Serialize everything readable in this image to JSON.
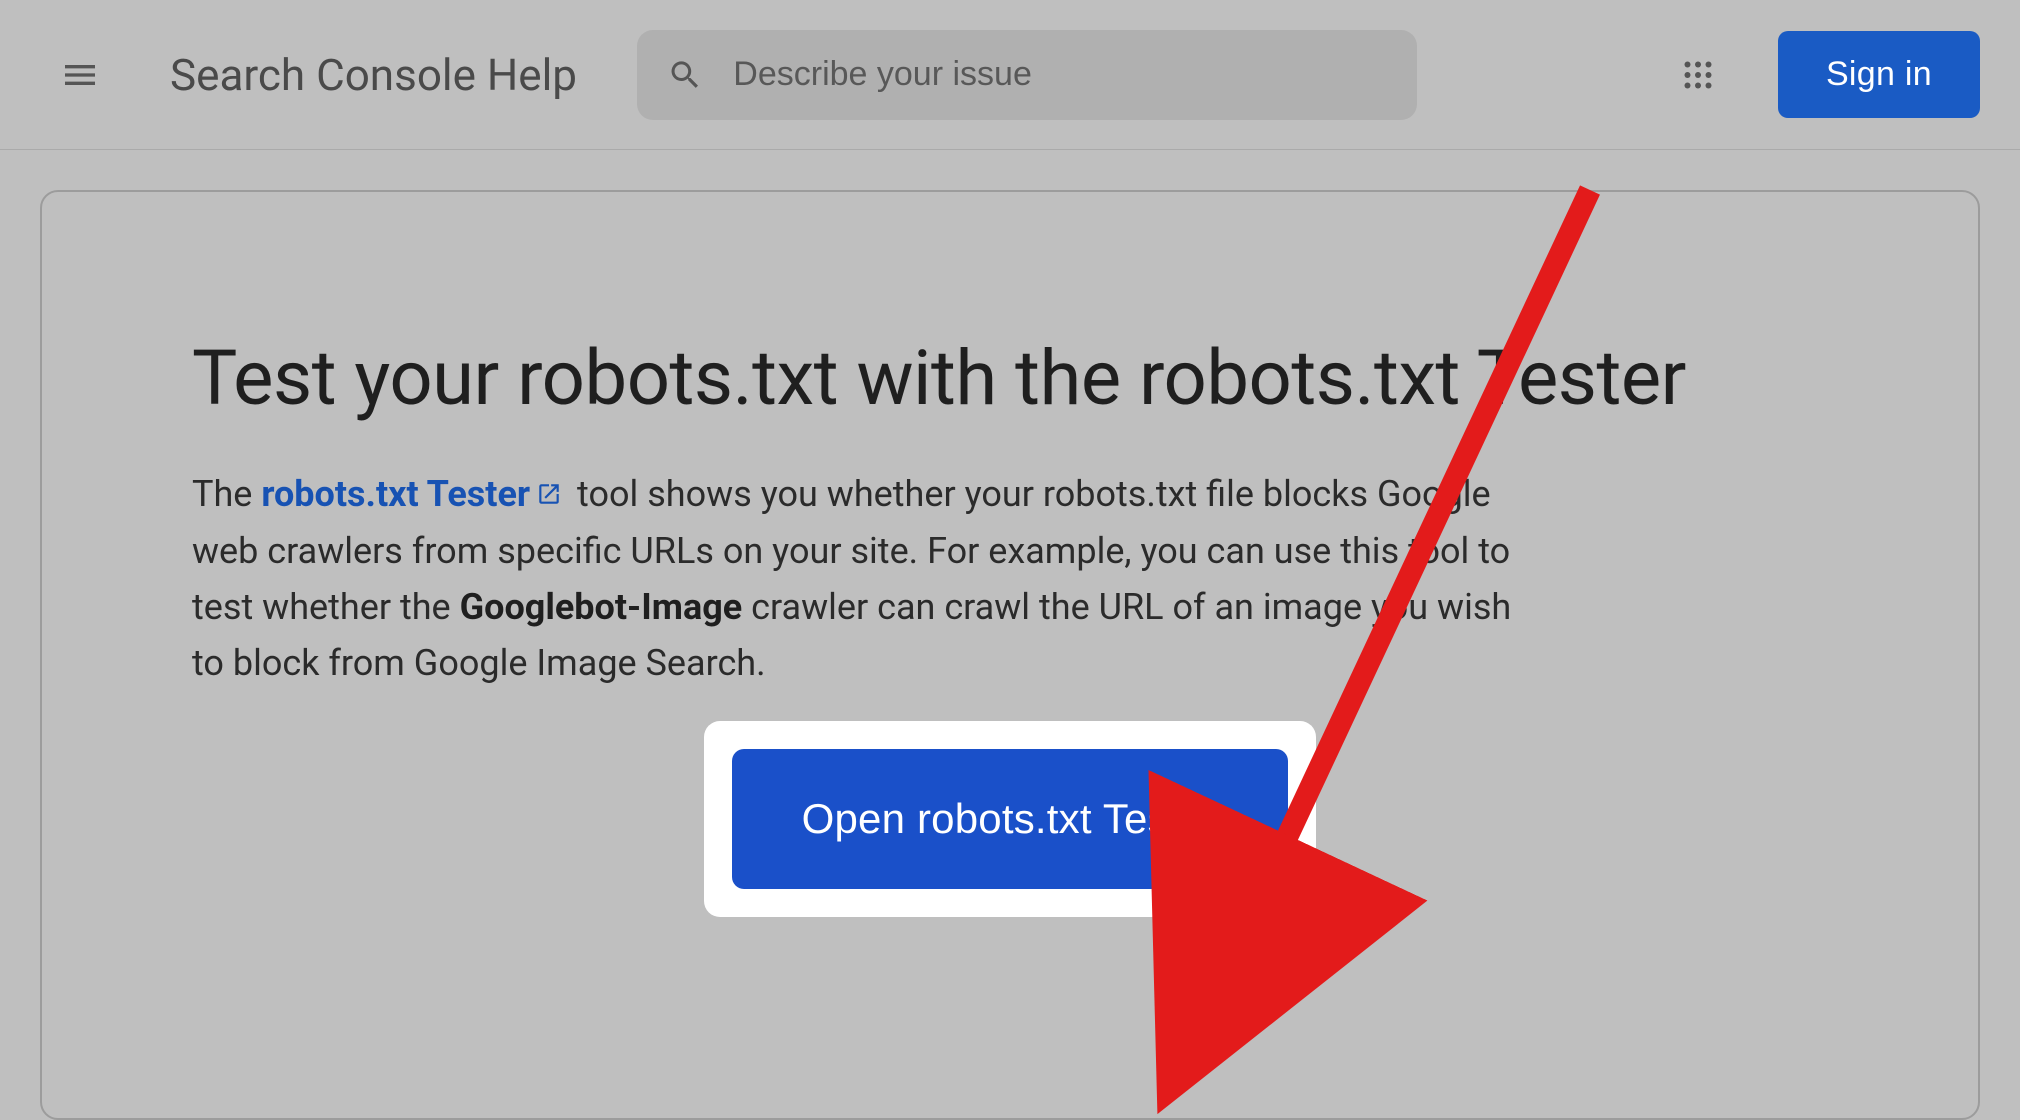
{
  "header": {
    "title": "Search Console Help",
    "search_placeholder": "Describe your issue",
    "signin_label": "Sign in"
  },
  "article": {
    "heading": "Test your robots.txt with the robots.txt Tester",
    "body_prefix": "The ",
    "link_text": "robots.txt Tester",
    "body_after_link": " tool shows you whether your robots.txt file blocks Google web crawlers from specific URLs on your site. For example, you can use this tool to test whether the ",
    "bold_text": "Googlebot-Image",
    "body_after_bold": " crawler can crawl the URL of an image you wish to block from Google Image Search.",
    "cta_label": "Open robots.txt Tester"
  }
}
